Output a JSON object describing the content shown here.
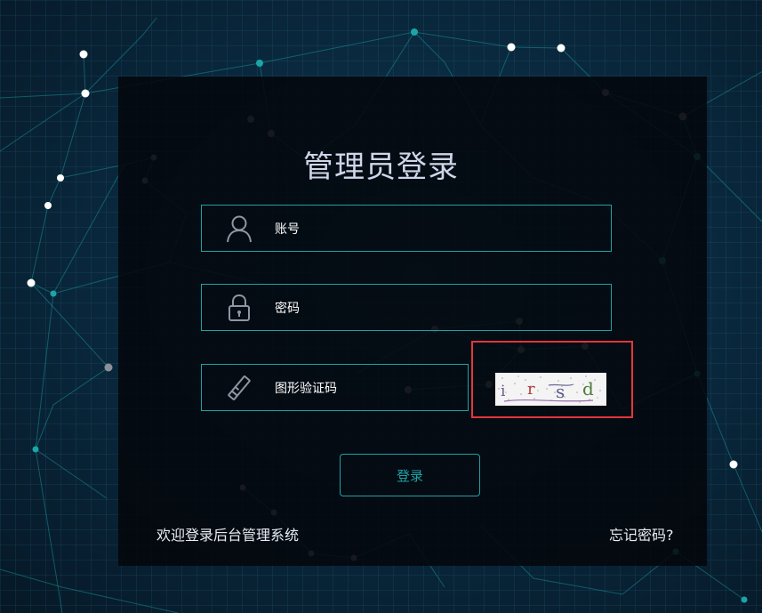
{
  "login": {
    "title": "管理员登录",
    "username_placeholder": "账号",
    "password_placeholder": "密码",
    "captcha_placeholder": "图形验证码",
    "captcha_text": "irsd",
    "submit_label": "登录",
    "welcome_text": "欢迎登录后台管理系统",
    "forgot_link": "忘记密码?"
  },
  "icons": {
    "username": "user-icon",
    "password": "lock-icon",
    "captcha": "key-icon"
  },
  "colors": {
    "accent": "#1fa2a5",
    "highlight_box": "#e2373a",
    "title": "#cfd6ea"
  }
}
